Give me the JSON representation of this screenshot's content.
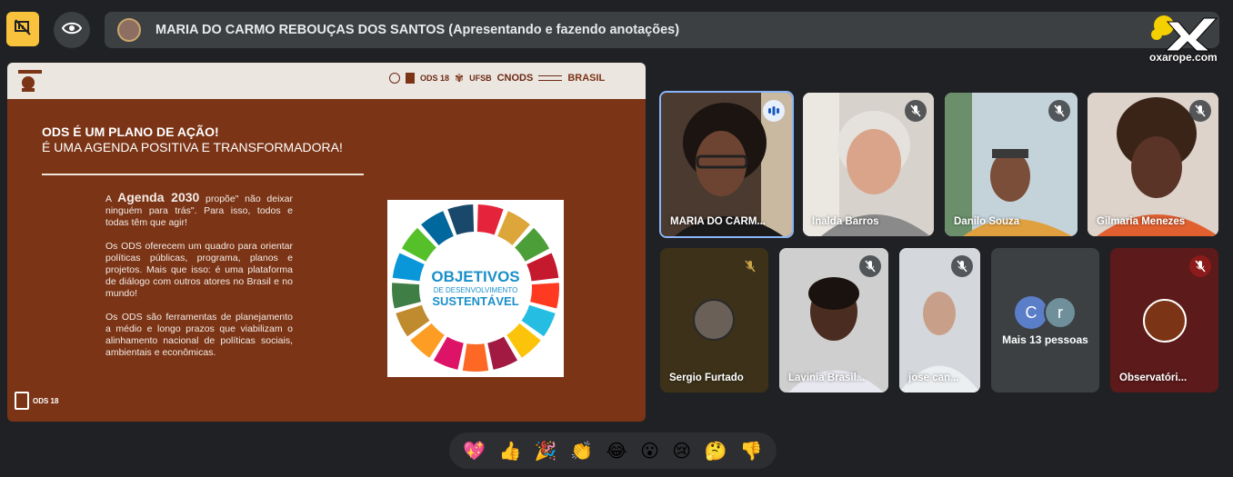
{
  "topbar": {
    "presenter_text": "MARIA DO CARMO REBOUÇAS DOS SANTOS (Apresentando e fazendo anotações)",
    "present_icon": "present-off-icon",
    "eye_icon": "eye-icon"
  },
  "watermark": {
    "text": "oxarope.com",
    "mark": "X"
  },
  "slide": {
    "title1": "ODS É UM PLANO DE AÇÃO!",
    "title2": "É UMA AGENDA POSITIVA E TRANSFORMADORA!",
    "p1_prefix": "A ",
    "p1_bold": "Agenda 2030",
    "p1_rest": " propõe\" não deixar ninguém para trás\". Para isso, todos e todas têm que agir!",
    "p2": "Os ODS oferecem um quadro para orientar políticas públicas, programa, planos e projetos. Mais que isso: é uma plataforma de diálogo com outros atores no Brasil e no mundo!",
    "p3": "Os ODS são ferramentas de planejamento a médio e longo prazos que viabilizam o alinhamento nacional de políticas sociais, ambientais e econômicas.",
    "sdg_line1": "OBJETIVOS",
    "sdg_line2": "DE DESENVOLVIMENTO",
    "sdg_line3": "SUSTENTÁVEL",
    "header_logos": [
      "ODS 18",
      "UFSB",
      "CNODS",
      "BRASIL"
    ],
    "footer_logo": "ODS 18"
  },
  "participants": [
    {
      "name": "MARIA DO CARM...",
      "mic": "speaking"
    },
    {
      "name": "Inalda Barros",
      "mic": "muted"
    },
    {
      "name": "Danilo Souza",
      "mic": "muted"
    },
    {
      "name": "Gilmaria Menezes",
      "mic": "muted"
    },
    {
      "name": "Sergio Furtado",
      "mic": "muted"
    },
    {
      "name": "Lavinia Brasil...",
      "mic": "muted"
    },
    {
      "name": "jose can...",
      "mic": "muted"
    },
    {
      "name": "Mais 13 pessoas",
      "initials": [
        "C",
        "r"
      ]
    },
    {
      "name": "Observatóri...",
      "mic": "muted"
    }
  ],
  "reactions": [
    "💖",
    "👍",
    "🎉",
    "👏",
    "😂",
    "😮",
    "😢",
    "🤔",
    "👎"
  ],
  "colors": {
    "accent": "#f9c23c",
    "slide_bg": "#7b3416",
    "speaking": "#8ab4f8"
  }
}
